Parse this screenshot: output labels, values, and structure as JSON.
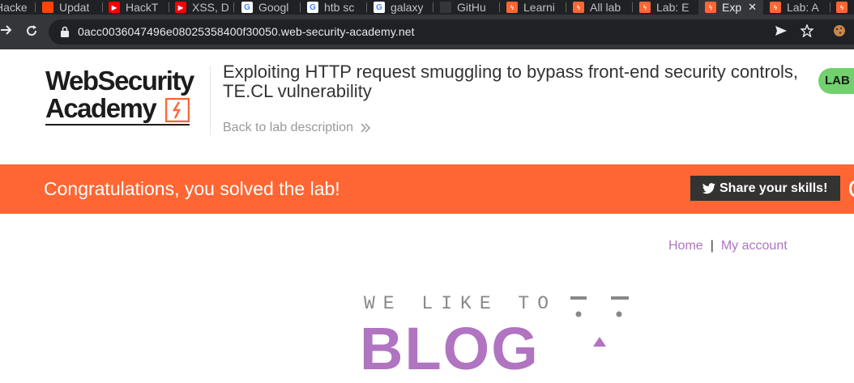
{
  "browser": {
    "tabs": [
      {
        "label": "Hacke",
        "icon": "page-icon"
      },
      {
        "label": "Updat",
        "icon": "reddit-icon"
      },
      {
        "label": "HackT",
        "icon": "youtube-icon"
      },
      {
        "label": "XSS, D",
        "icon": "youtube-icon"
      },
      {
        "label": "Googl",
        "icon": "google-icon"
      },
      {
        "label": "htb sc",
        "icon": "google-icon"
      },
      {
        "label": "galaxy",
        "icon": "google-icon"
      },
      {
        "label": "GitHu",
        "icon": "github-icon"
      },
      {
        "label": "Learni",
        "icon": "portswigger-icon"
      },
      {
        "label": "All lab",
        "icon": "portswigger-icon"
      },
      {
        "label": "Lab: E",
        "icon": "portswigger-icon"
      },
      {
        "label": "Exp",
        "icon": "portswigger-icon",
        "active": true
      },
      {
        "label": "Lab: A",
        "icon": "portswigger-icon"
      }
    ],
    "tab_close_glyph": "✕",
    "url": "0acc0036047496e08025358400f30050.web-security-academy.net"
  },
  "header": {
    "logo_line1": "WebSecurity",
    "logo_line2": "Academy",
    "lab_title": "Exploiting HTTP request smuggling to bypass front-end security controls, TE.CL vulnerability",
    "back_link": "Back to lab description",
    "lab_status_badge": "LAB"
  },
  "banner": {
    "message": "Congratulations, you solved the lab!",
    "share_button": "Share your skills!"
  },
  "blog": {
    "nav_home": "Home",
    "nav_separator": "|",
    "nav_account": "My account",
    "logo_small": "WE LIKE TO",
    "logo_big": "BLOG"
  },
  "colors": {
    "accent_orange": "#ff6633",
    "blog_purple": "#b074c1",
    "badge_green": "#70d16d"
  }
}
